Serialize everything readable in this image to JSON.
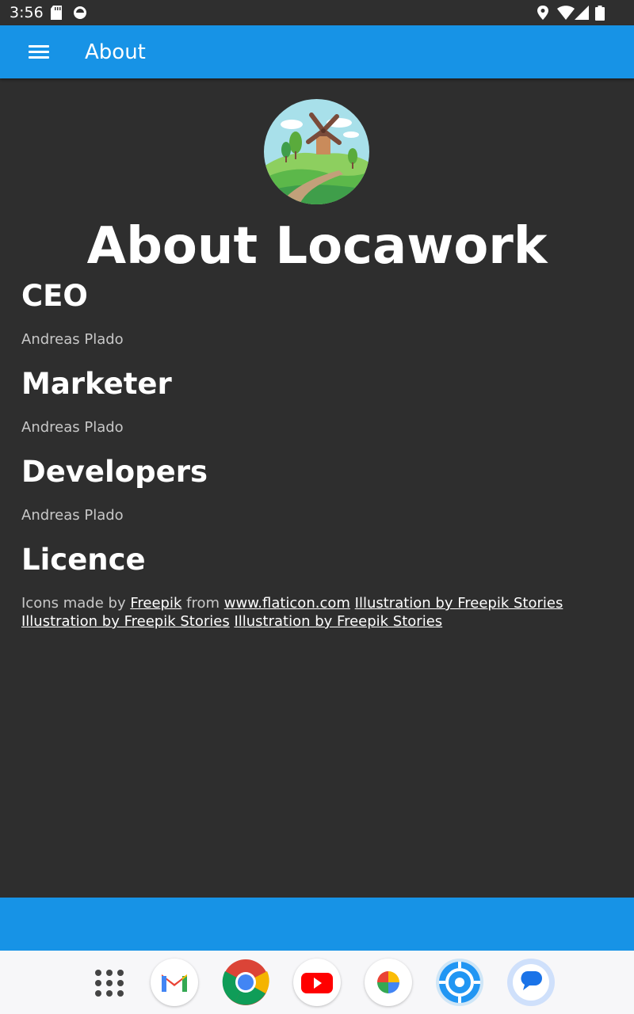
{
  "status_bar": {
    "time": "3:56",
    "icons": [
      "sd-card-icon",
      "notification-icon",
      "location-icon",
      "wifi-icon",
      "signal-icon",
      "battery-icon"
    ]
  },
  "app_bar": {
    "title": "About",
    "menu_icon": "hamburger-menu-icon",
    "color": "#1793e6"
  },
  "page": {
    "title": "About Locawork",
    "logo_icon": "windmill-landscape-logo",
    "sections": [
      {
        "heading": "CEO",
        "text": "Andreas Plado"
      },
      {
        "heading": "Marketer",
        "text": "Andreas Plado"
      },
      {
        "heading": "Developers",
        "text": "Andreas Plado"
      },
      {
        "heading": "Licence"
      }
    ],
    "licence": {
      "prefix": "Icons made by",
      "freepik": "Freepik",
      "from": "from",
      "flaticon": "www.flaticon.com",
      "illustration_1": "Illustration by Freepik Stories",
      "illustration_2": "Illustration by Freepik Stories",
      "illustration_3": "Illustration by Freepik Stories"
    }
  },
  "dock": {
    "apps": [
      "app-drawer-icon",
      "gmail-icon",
      "chrome-icon",
      "youtube-icon",
      "photos-icon",
      "locawork-app-icon",
      "messages-icon"
    ]
  },
  "colors": {
    "background": "#2e2e2e",
    "accent": "#1793e6",
    "text_secondary": "#c8c8c8"
  }
}
